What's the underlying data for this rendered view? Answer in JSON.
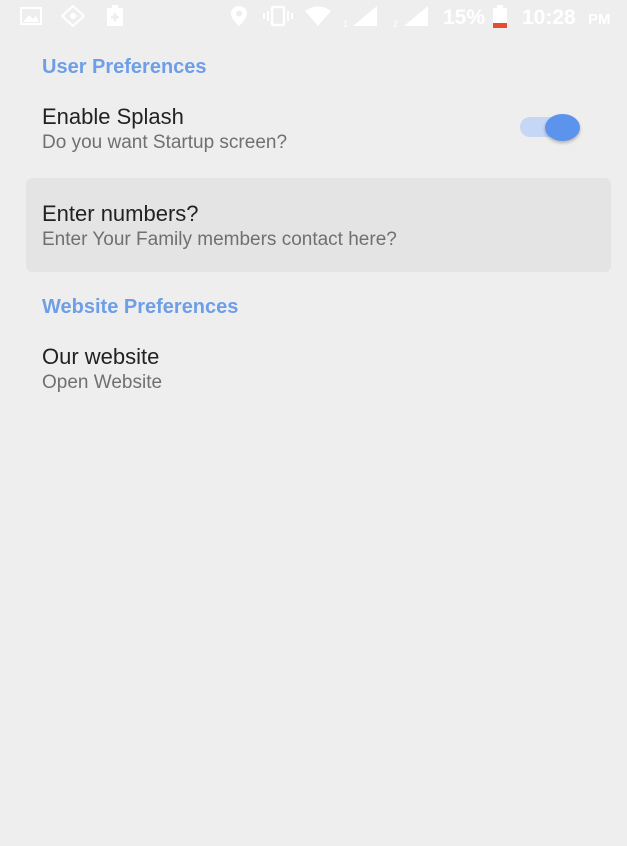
{
  "status_bar": {
    "battery": "15%",
    "time": "10:28",
    "ampm": "PM",
    "sim1": "1",
    "sim2": "2"
  },
  "user_prefs": {
    "category": "User Preferences",
    "splash_title": "Enable Splash",
    "splash_summary": "Do you want Startup screen?",
    "splash_enabled": true,
    "numbers_title": "Enter numbers?",
    "numbers_summary": "Enter Your Family members contact here?"
  },
  "website_prefs": {
    "category": "Website Preferences",
    "site_title": "Our website",
    "site_summary": "Open Website"
  },
  "colors": {
    "accent": "#6e9fe6",
    "switch_on": "#5b93ed"
  }
}
